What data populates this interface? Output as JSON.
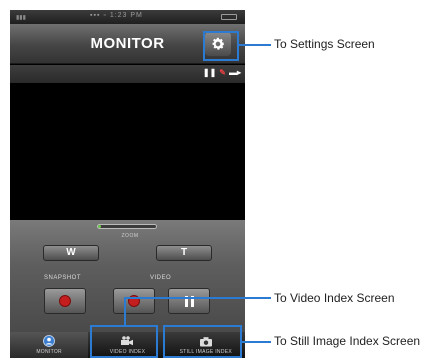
{
  "screen": {
    "title": "MONITOR",
    "status_carrier": "▪▪▪ ▫ 1:23 PM",
    "zoom_label": "ZOOM",
    "zoom_level": 0.05,
    "zoom_wide": "W",
    "zoom_tele": "T",
    "snapshot_label": "SNAPSHOT",
    "video_label": "VIDEO",
    "strip_icons": [
      "pause-indicator-icon",
      "pen-icon",
      "battery-icon"
    ]
  },
  "tabs": [
    {
      "label": "MONITOR",
      "icon": "monitor-icon",
      "active": true
    },
    {
      "label": "VIDEO INDEX",
      "icon": "video-camera-icon",
      "active": false
    },
    {
      "label": "STILL IMAGE INDEX",
      "icon": "camera-icon",
      "active": false
    }
  ],
  "callouts": {
    "settings": "To Settings Screen",
    "video_index": "To Video Index Screen",
    "still_index": "To Still Image Index Screen"
  },
  "colors": {
    "callout": "#2b7bd3",
    "record": "#c41e1e",
    "zoom_fill": "#6fcf4d"
  }
}
